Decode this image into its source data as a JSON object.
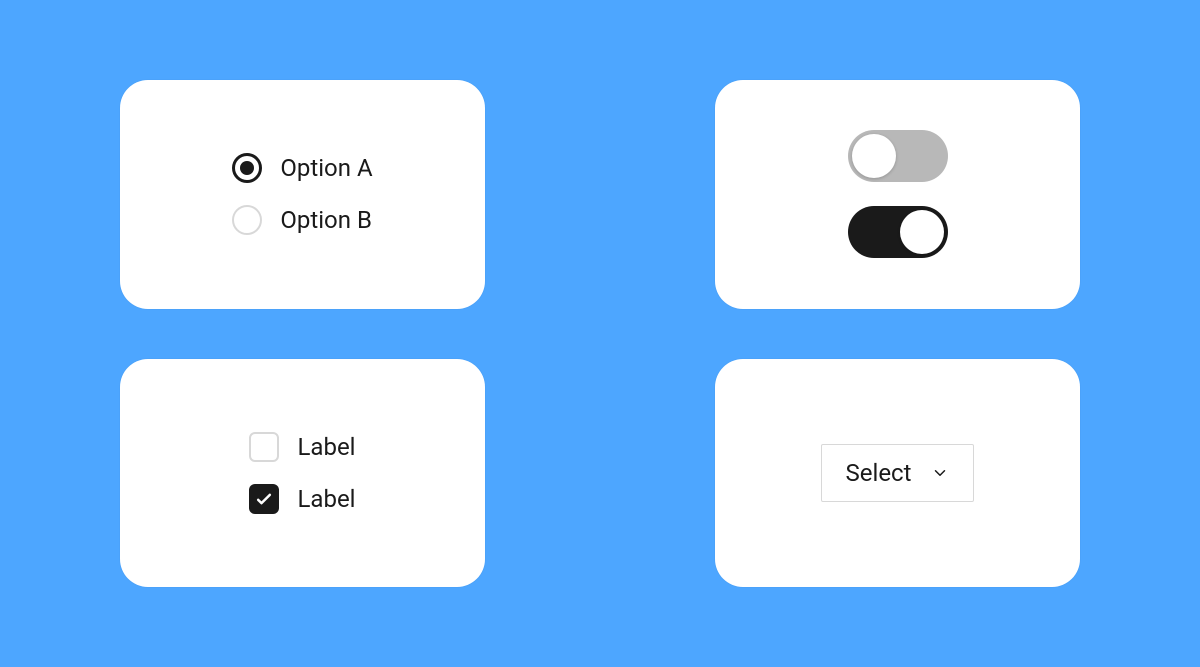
{
  "radios": {
    "options": [
      {
        "label": "Option A",
        "selected": true
      },
      {
        "label": "Option B",
        "selected": false
      }
    ]
  },
  "checkboxes": {
    "items": [
      {
        "label": "Label",
        "checked": false
      },
      {
        "label": "Label",
        "checked": true
      }
    ]
  },
  "toggles": {
    "items": [
      {
        "state": "off"
      },
      {
        "state": "on"
      }
    ]
  },
  "select": {
    "placeholder": "Select"
  }
}
